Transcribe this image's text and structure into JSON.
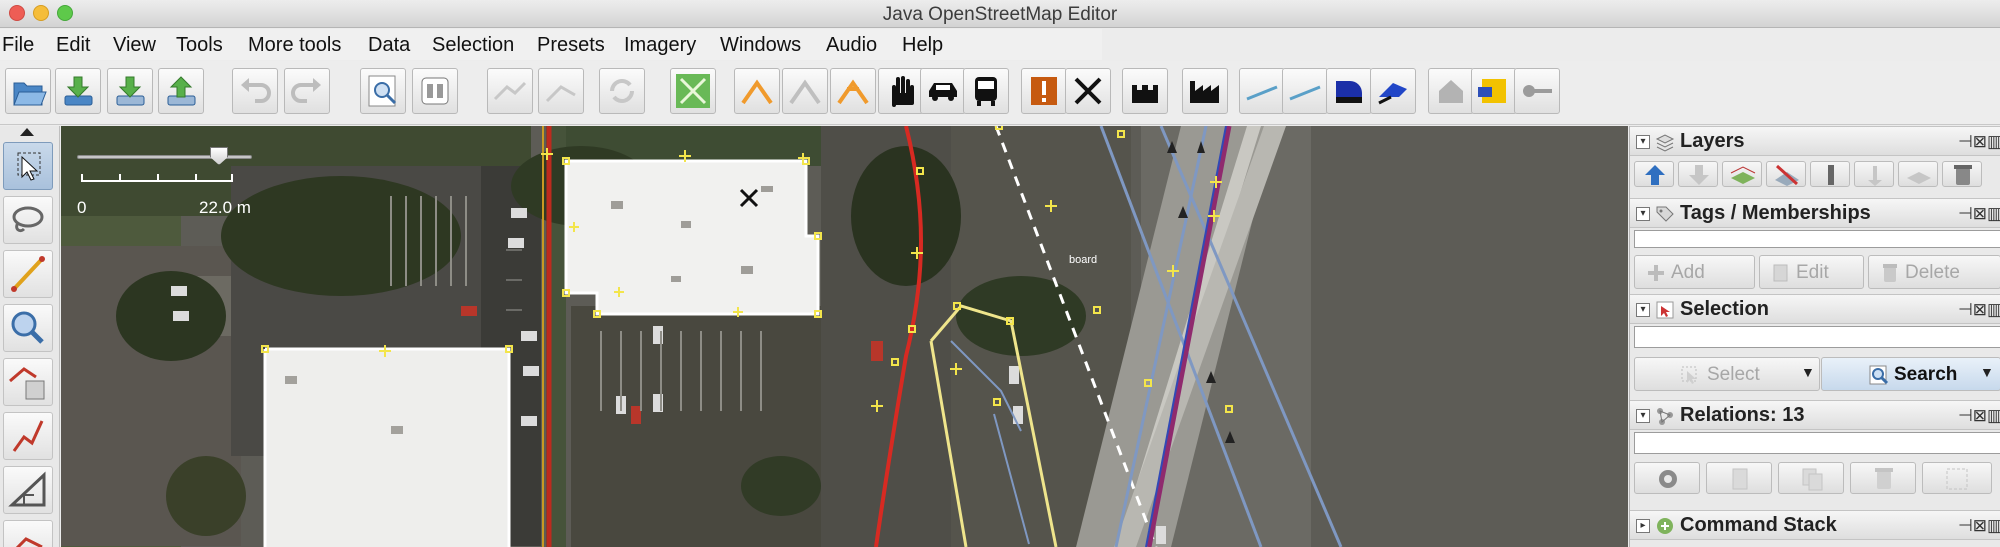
{
  "window": {
    "title": "Java OpenStreetMap Editor"
  },
  "menu": {
    "items": [
      "File",
      "Edit",
      "View",
      "Tools",
      "More tools",
      "Data",
      "Selection",
      "Presets",
      "Imagery",
      "Windows",
      "Audio",
      "Help"
    ]
  },
  "toolbar": {
    "buttons": [
      "open-icon",
      "download-icon",
      "download-along-icon",
      "upload-icon",
      "undo-icon",
      "redo-icon",
      "zoom-preferences-icon",
      "preferences-icon",
      "split-way-icon",
      "combine-way-icon",
      "reverse-way-icon",
      "wireframe-icon",
      "road-preset-icon",
      "road-preset-2-icon",
      "road-preset-3-icon",
      "hand-preset-icon",
      "car-preset-icon",
      "bus-preset-icon",
      "warning-preset-icon",
      "restaurant-preset-icon",
      "castle-preset-icon",
      "industrial-preset-icon",
      "line-preset-icon",
      "line-preset-2-icon",
      "building-preset-icon",
      "flag-preset-icon",
      "house-preset-icon",
      "shop-preset-icon",
      "key-preset-icon"
    ]
  },
  "map_tools": [
    "select-tool-icon",
    "lasso-tool-icon",
    "draw-tool-icon",
    "zoom-tool-icon",
    "delete-tool-icon",
    "parallel-tool-icon",
    "improve-tool-icon",
    "extrude-tool-icon"
  ],
  "map": {
    "scale": {
      "min": "0",
      "value": "22.0 m",
      "zoom_level": 0.78
    },
    "label": "board"
  },
  "panels": {
    "layers": {
      "title": "Layers"
    },
    "tags": {
      "title": "Tags / Memberships",
      "buttons": [
        "Add",
        "Edit",
        "Delete"
      ]
    },
    "selection": {
      "title": "Selection",
      "buttons": [
        "Select",
        "Search"
      ]
    },
    "relations": {
      "title": "Relations: 13"
    },
    "command_stack": {
      "title": "Command Stack"
    }
  },
  "colors": {
    "accent": "#3d79c8",
    "road_red": "#d72a22",
    "building_outline": "#ffffff",
    "selection_yellow": "#f4ec6a",
    "highway_blue": "#7f98c2"
  }
}
